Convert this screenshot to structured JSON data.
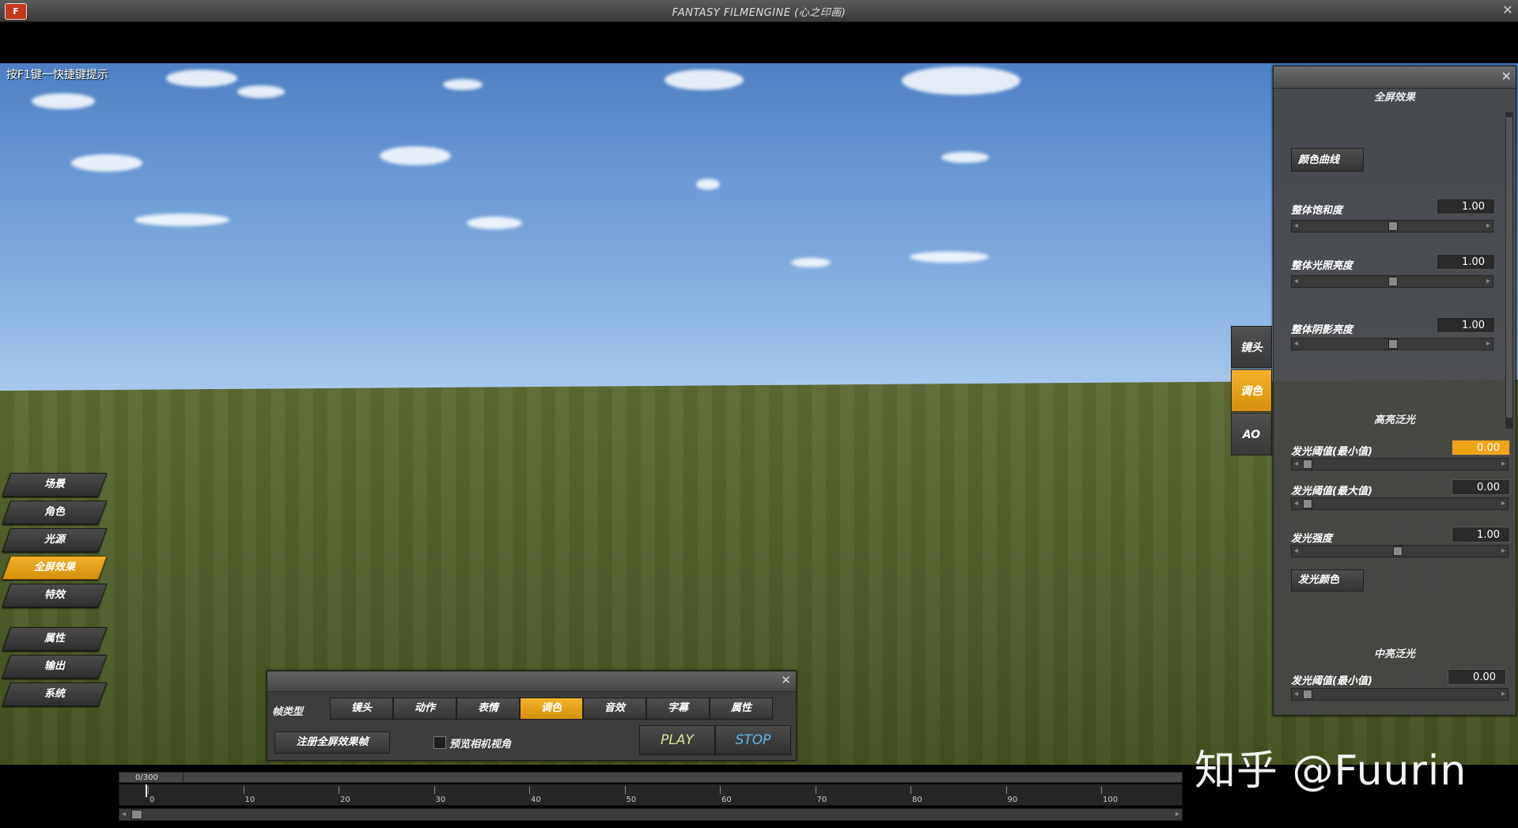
{
  "window": {
    "title": "FANTASY FILMENGINE (心之印画)",
    "logo_text": "F",
    "close": "✕"
  },
  "viewport": {
    "hint": "按F1键一快捷键提示"
  },
  "nav": {
    "group1": [
      "场景",
      "角色",
      "光源",
      "全屏效果",
      "特效"
    ],
    "group2": [
      "属性",
      "输出",
      "系统"
    ],
    "active": "全屏效果"
  },
  "side_tabs": [
    {
      "label": "镜头",
      "active": false
    },
    {
      "label": "调色",
      "active": true
    },
    {
      "label": "AO",
      "active": false
    }
  ],
  "fx_panel": {
    "title": "全屏效果",
    "close": "✕",
    "color_curve_btn": "颜色曲线",
    "params": [
      {
        "label": "整体饱和度",
        "value": "1.00",
        "level": 0.5
      },
      {
        "label": "整体光照亮度",
        "value": "1.00",
        "level": 0.5
      },
      {
        "label": "整体阴影亮度",
        "value": "1.00",
        "level": 0.5
      }
    ],
    "bloom_high": {
      "title": "高亮泛光",
      "params": [
        {
          "label": "发光阈值(最小值)",
          "value": "0.00",
          "level": 0.0,
          "highlight": true
        },
        {
          "label": "发光阈值(最大值)",
          "value": "0.00",
          "level": 0.0,
          "highlight": false
        },
        {
          "label": "发光强度",
          "value": "1.00",
          "level": 0.5,
          "highlight": false
        }
      ],
      "color_btn": "发光颜色"
    },
    "bloom_mid": {
      "title": "中亮泛光",
      "params": [
        {
          "label": "发光阈值(最小值)",
          "value": "0.00",
          "level": 0.0
        }
      ]
    }
  },
  "keyframe_panel": {
    "close": "✕",
    "type_label": "帧类型",
    "tabs": [
      "镜头",
      "动作",
      "表情",
      "调色",
      "音效",
      "字幕",
      "属性"
    ],
    "active_tab": "调色",
    "register_btn": "注册全屏效果帧",
    "preview_label": "预览相机视角",
    "preview_checked": false,
    "play": "PLAY",
    "stop": "STOP"
  },
  "timeline": {
    "counter": "0/300",
    "ticks": [
      "0",
      "10",
      "20",
      "30",
      "40",
      "50",
      "60",
      "70",
      "80",
      "90",
      "100"
    ]
  },
  "watermark": "知乎 @Fuurin",
  "colors": {
    "accent": "#e9a515",
    "panel": "#464646"
  }
}
